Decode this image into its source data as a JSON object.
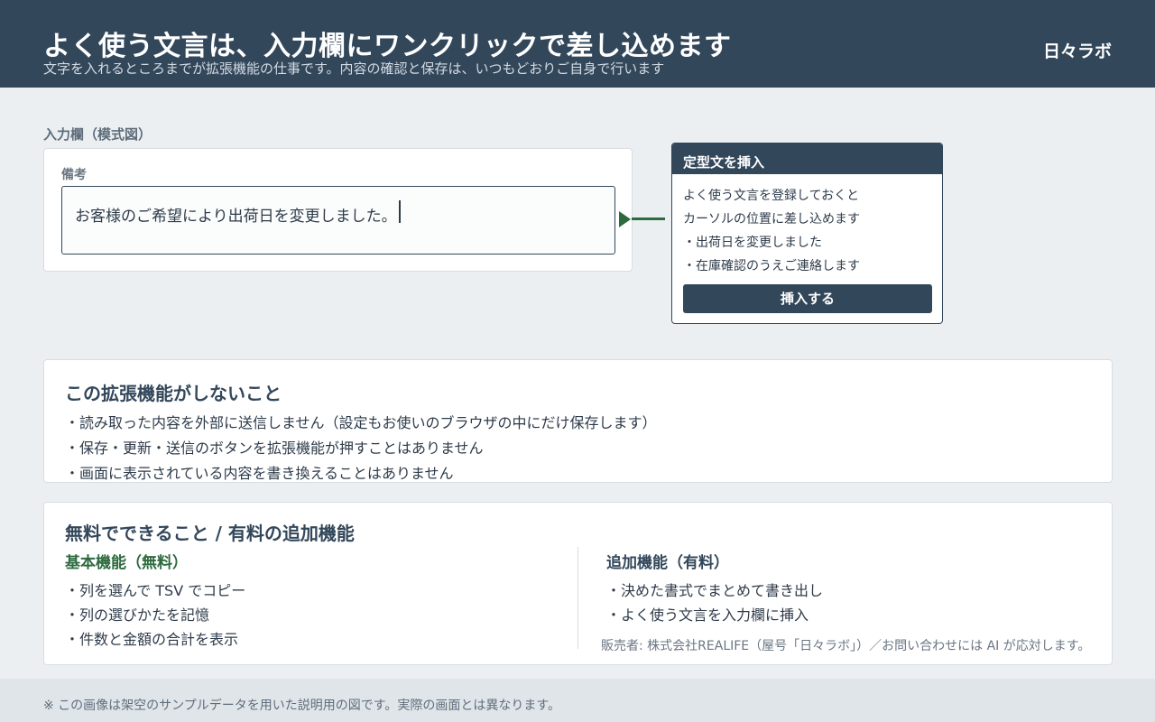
{
  "header": {
    "title": "よく使う文言は、入力欄にワンクリックで差し込めます",
    "subtitle": "文字を入れるところまでが拡張機能の仕事です。内容の確認と保存は、いつもどおりご自身で行います",
    "brand": "日々ラボ"
  },
  "input_section": {
    "label": "入力欄（模式図）",
    "field_label": "備考",
    "field_value": "お客様のご希望により出荷日を変更しました。"
  },
  "popup": {
    "title": "定型文を挿入",
    "lines": [
      "よく使う文言を登録しておくと",
      "カーソルの位置に差し込めます",
      "・出荷日を変更しました",
      "・在庫確認のうえご連絡します"
    ],
    "button_label": "挿入する"
  },
  "not_do": {
    "title": "この拡張機能がしないこと",
    "items": [
      "・読み取った内容を外部に送信しません（設定もお使いのブラウザの中にだけ保存します）",
      "・保存・更新・送信のボタンを拡張機能が押すことはありません",
      "・画面に表示されている内容を書き換えることはありません"
    ]
  },
  "plans": {
    "title": "無料でできること / 有料の追加機能",
    "free_title": "基本機能（無料）",
    "free_items": [
      "・列を選んで TSV でコピー",
      "・列の選びかたを記憶",
      "・件数と金額の合計を表示"
    ],
    "paid_title": "追加機能（有料）",
    "paid_items": [
      "・決めた書式でまとめて書き出し",
      "・よく使う文言を入力欄に挿入"
    ],
    "seller": "販売者: 株式会社REALIFE（屋号「日々ラボ」）／お問い合わせには AI が応対します。"
  },
  "footer": {
    "note": "※ この画像は架空のサンプルデータを用いた説明用の図です。実際の画面とは異なります。"
  },
  "colors": {
    "header_bg": "#33475b",
    "accent_green": "#2d6a3e",
    "page_bg": "#ebeff2"
  }
}
